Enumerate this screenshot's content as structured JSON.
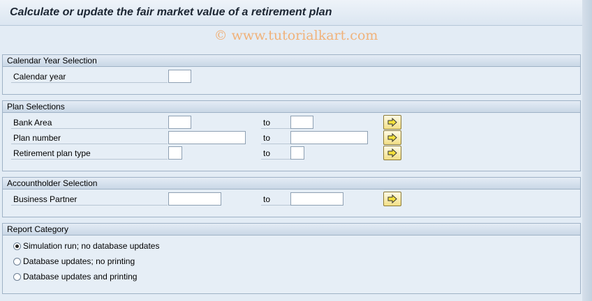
{
  "page": {
    "title": "Calculate or update the fair market value of a retirement plan",
    "watermark": "© www.tutorialkart.com"
  },
  "calendar_year_selection": {
    "header": "Calendar Year Selection",
    "calendar_year_label": "Calendar year",
    "calendar_year_value": ""
  },
  "plan_selections": {
    "header": "Plan Selections",
    "to_label": "to",
    "rows": [
      {
        "label": "Bank Area",
        "from": "",
        "to": ""
      },
      {
        "label": "Plan number",
        "from": "",
        "to": ""
      },
      {
        "label": "Retirement plan type",
        "from": "",
        "to": ""
      }
    ]
  },
  "accountholder_selection": {
    "header": "Accountholder Selection",
    "to_label": "to",
    "business_partner_label": "Business Partner",
    "from": "",
    "to": ""
  },
  "report_category": {
    "header": "Report Category",
    "options": [
      {
        "label": "Simulation run; no database updates",
        "selected": true
      },
      {
        "label": "Database updates; no printing",
        "selected": false
      },
      {
        "label": "Database updates and printing",
        "selected": false
      }
    ]
  },
  "icons": {
    "multiple_selection": "arrow-right-icon",
    "multiple_selection_color": "#f2df86"
  }
}
